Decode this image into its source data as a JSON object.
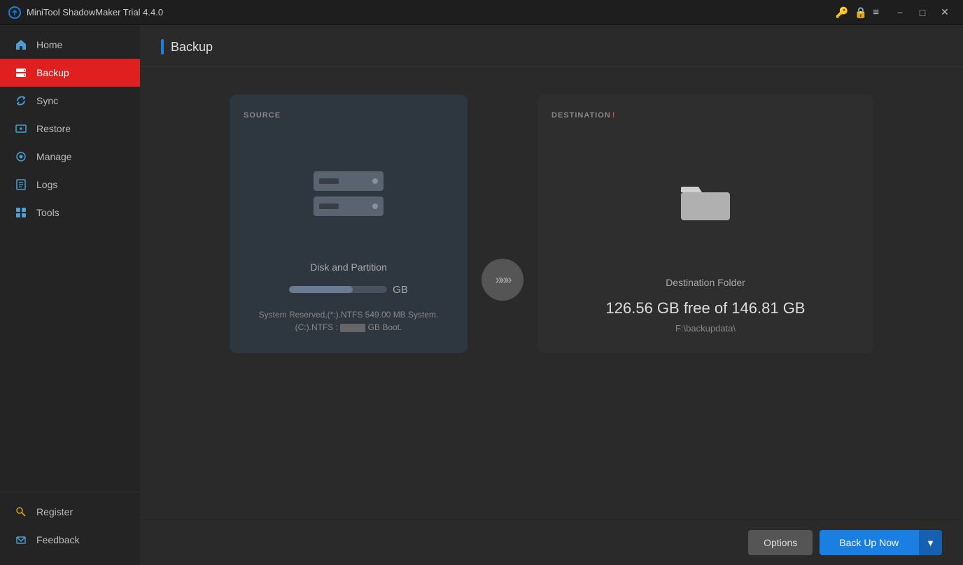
{
  "titleBar": {
    "appName": "MiniTool ShadowMaker Trial 4.4.0",
    "minimize": "−",
    "maximize": "□",
    "close": "✕"
  },
  "sidebar": {
    "items": [
      {
        "id": "home",
        "label": "Home",
        "icon": "home-icon",
        "active": false
      },
      {
        "id": "backup",
        "label": "Backup",
        "icon": "backup-icon",
        "active": true
      },
      {
        "id": "sync",
        "label": "Sync",
        "icon": "sync-icon",
        "active": false
      },
      {
        "id": "restore",
        "label": "Restore",
        "icon": "restore-icon",
        "active": false
      },
      {
        "id": "manage",
        "label": "Manage",
        "icon": "manage-icon",
        "active": false
      },
      {
        "id": "logs",
        "label": "Logs",
        "icon": "logs-icon",
        "active": false
      },
      {
        "id": "tools",
        "label": "Tools",
        "icon": "tools-icon",
        "active": false
      }
    ],
    "bottomItems": [
      {
        "id": "register",
        "label": "Register",
        "icon": "key-icon"
      },
      {
        "id": "feedback",
        "label": "Feedback",
        "icon": "mail-icon"
      }
    ]
  },
  "pageTitle": "Backup",
  "source": {
    "label": "SOURCE",
    "iconType": "disk",
    "cardLabel": "Disk and Partition",
    "sizeText": "GB",
    "detailLine1": "System Reserved,(*:).NTFS 549.00 MB System.",
    "detailLine2": "(C:).NTFS :    GB Boot."
  },
  "destination": {
    "label": "DESTINATION",
    "badge": "!",
    "iconType": "folder",
    "cardLabel": "Destination Folder",
    "freeSize": "126.56 GB free of 146.81 GB",
    "path": "F:\\backupdata\\"
  },
  "arrow": {
    "symbol": "»»»"
  },
  "buttons": {
    "options": "Options",
    "backupNow": "Back Up Now",
    "dropdownArrow": "▼"
  }
}
